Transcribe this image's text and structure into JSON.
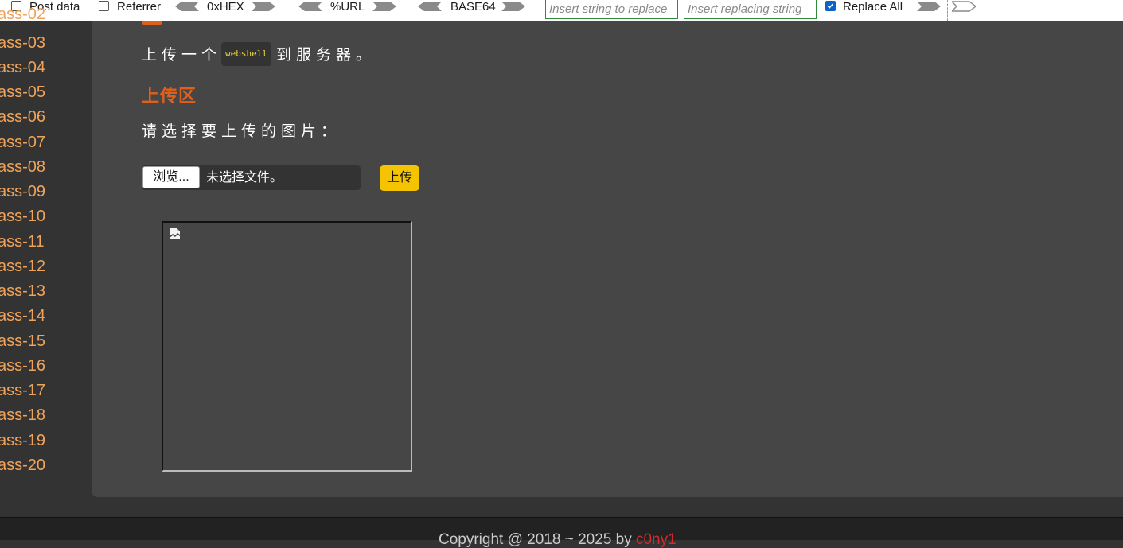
{
  "toolbar": {
    "post_data_label": "Post data",
    "post_data_checked": false,
    "referrer_label": "Referrer",
    "referrer_checked": false,
    "hex_label": "0xHEX",
    "url_label": "%URL",
    "base64_label": "BASE64",
    "replace_input_placeholder": "Insert string to replace",
    "replacing_input_placeholder": "Insert replacing string",
    "replace_all_label": "Replace All",
    "replace_all_checked": true
  },
  "sidebar": {
    "items": [
      {
        "label": "ass-02"
      },
      {
        "label": "ass-03"
      },
      {
        "label": "ass-04"
      },
      {
        "label": "ass-05"
      },
      {
        "label": "ass-06"
      },
      {
        "label": "ass-07"
      },
      {
        "label": "ass-08"
      },
      {
        "label": "ass-09"
      },
      {
        "label": "ass-10"
      },
      {
        "label": "ass-11"
      },
      {
        "label": "ass-12"
      },
      {
        "label": "ass-13"
      },
      {
        "label": "ass-14"
      },
      {
        "label": "ass-15"
      },
      {
        "label": "ass-16"
      },
      {
        "label": "ass-17"
      },
      {
        "label": "ass-18"
      },
      {
        "label": "ass-19"
      },
      {
        "label": "ass-20"
      }
    ]
  },
  "main": {
    "description_before": "上传一个",
    "description_code": "webshell",
    "description_after": "到服务器。",
    "section_title": "上传区",
    "prompt": "请选择要上传的图片：",
    "browse_button": "浏览...",
    "file_status": "未选择文件。",
    "upload_button": "上传"
  },
  "footer": {
    "text": "Copyright @ 2018 ~ 2025 by ",
    "brand": "c0ny1"
  },
  "colors": {
    "accent_orange": "#e0601b",
    "sidebar_link": "#f0a35a",
    "upload_button": "#f5c400",
    "code_text": "#e8d23a"
  }
}
